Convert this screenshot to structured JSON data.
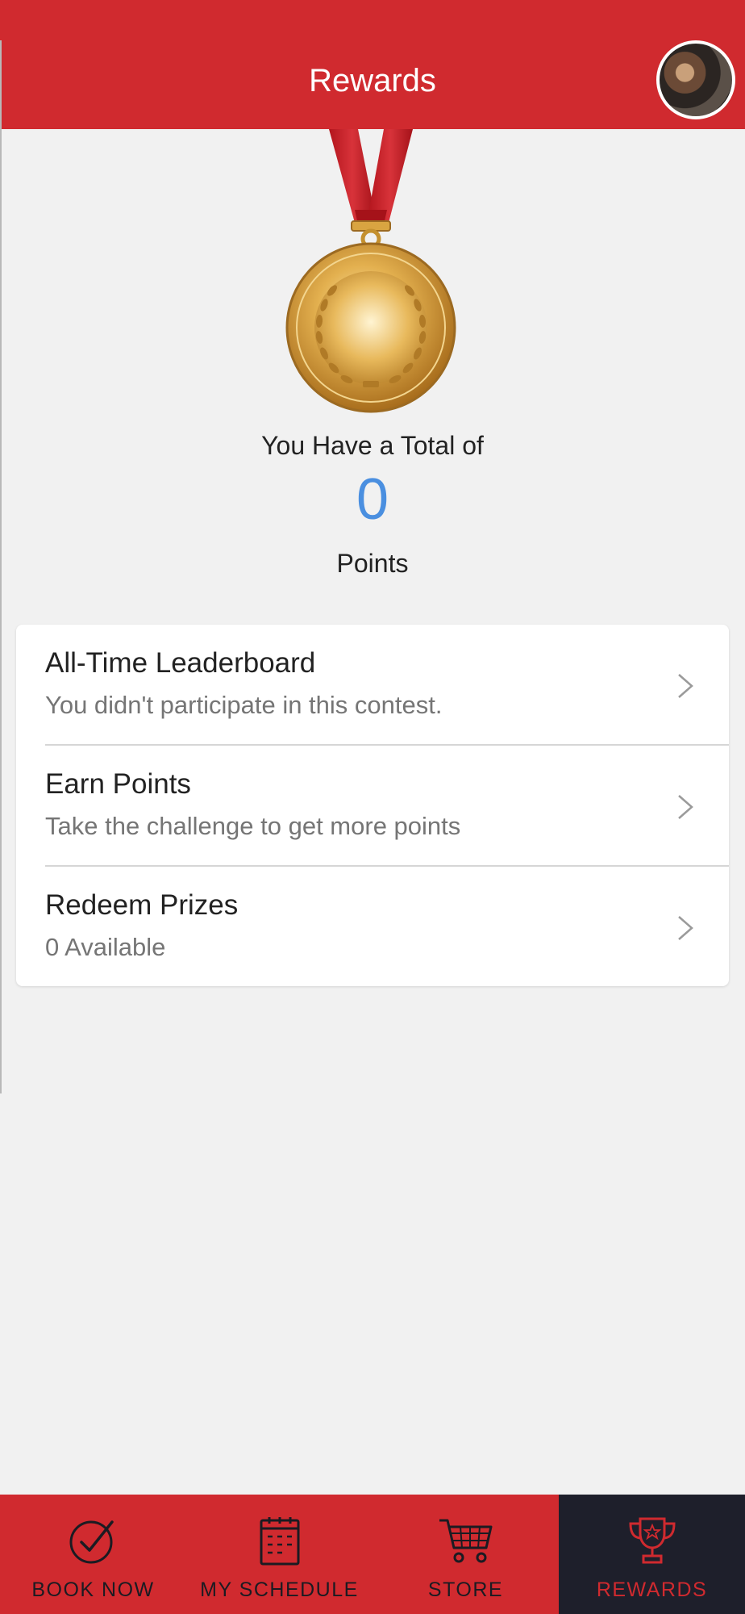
{
  "header": {
    "title": "Rewards"
  },
  "summary": {
    "total_label": "You Have a Total of",
    "points_value": "0",
    "points_label": "Points"
  },
  "menu": [
    {
      "title": "All-Time Leaderboard",
      "subtitle": "You didn't participate in this contest."
    },
    {
      "title": "Earn Points",
      "subtitle": "Take the challenge to get more points"
    },
    {
      "title": "Redeem Prizes",
      "subtitle": "0 Available"
    }
  ],
  "bottom_nav": [
    {
      "label": "BOOK NOW",
      "icon": "check-circle-icon",
      "active": false
    },
    {
      "label": "MY SCHEDULE",
      "icon": "calendar-icon",
      "active": false
    },
    {
      "label": "STORE",
      "icon": "cart-icon",
      "active": false
    },
    {
      "label": "REWARDS",
      "icon": "trophy-icon",
      "active": true
    }
  ],
  "colors": {
    "brand_red": "#d02a2f",
    "nav_active_bg": "#1e1f2b",
    "points_blue": "#4a8fe0",
    "medal_gold": "#d9a441"
  }
}
